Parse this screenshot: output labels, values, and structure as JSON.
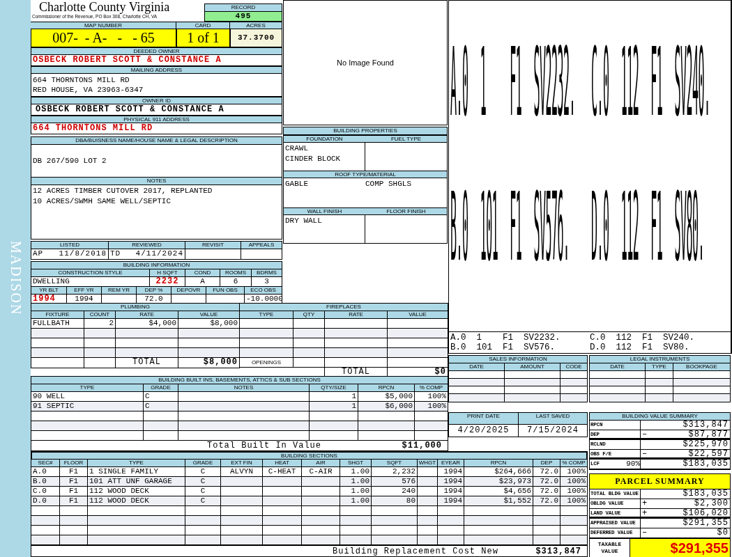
{
  "sidebar": {
    "district": "MADISON"
  },
  "header": {
    "county": "Charlotte County Virginia",
    "office": "Commissioner of the Revenue, PO Box 308, Charlotte CH, VA",
    "record_label": "RECORD",
    "record": "495"
  },
  "parcel": {
    "map_label": "MAP NUMBER",
    "map_number": "007-  - A-   -   - 65",
    "card_label": "CARD",
    "card": "1 of 1",
    "acres_label": "ACRES",
    "acres": "37.3700"
  },
  "owner": {
    "deeded_label": "DEEDED OWNER",
    "deeded": "OSBECK ROBERT SCOTT & CONSTANCE A",
    "mailing_label": "MAILING ADDRESS",
    "mailing_lines": [
      "664 THORNTONS MILL RD",
      "RED HOUSE, VA 23963-6347"
    ],
    "owner_id_label": "OWNER ID",
    "owner_id": "OSBECK ROBERT SCOTT & CONSTANCE A",
    "physical_label": "PHYSICAL 911 ADDRESS",
    "physical": "664 THORNTONS MILL RD"
  },
  "legal_description": {
    "label": "DBA/BUISNESS NAME/HOUSE NAME & LEGAL DESCRIPTION",
    "text": "DB 267/590 LOT 2"
  },
  "notes": {
    "label": "NOTES",
    "lines": [
      "12 ACRES TIMBER CUTOVER 2017, REPLANTED",
      "10 ACRES/SWMH SAME WELL/SEPTIC"
    ]
  },
  "review": {
    "columns": [
      "LISTED",
      "REVIEWED",
      "REVISIT",
      "APPEALS"
    ],
    "listed_by": "AP",
    "listed": "11/8/2018",
    "reviewed_by": "TD",
    "reviewed": "4/11/2024"
  },
  "building_info": {
    "title": "BUILDING INFORMATION",
    "construction": [
      {
        "label": "CONSTRUCTION STYLE",
        "value": "DWELLING",
        "highlight": false
      },
      {
        "label": "H SQFT",
        "value": "2232",
        "highlight": true
      },
      {
        "label": "COND",
        "value": "A",
        "highlight": false
      },
      {
        "label": "ROOMS",
        "value": "6",
        "highlight": false
      },
      {
        "label": "BDRMS",
        "value": "3",
        "highlight": false
      }
    ],
    "age": [
      {
        "label": "YR BLT",
        "value": "1994",
        "highlight": true
      },
      {
        "label": "EFF YR",
        "value": "1994",
        "highlight": false
      },
      {
        "label": "REM YR"
      },
      {
        "label": "DEP %",
        "value": "72.0",
        "highlight": false
      },
      {
        "label": "DEPOVR"
      },
      {
        "label": "FUN OBS"
      },
      {
        "label": "ECO OBS",
        "value": "-10.0000",
        "highlight": false
      }
    ]
  },
  "image": {
    "message": "No Image Found"
  },
  "building_properties": {
    "title": "BUILDING PROPERTIES",
    "foundation_label": "FOUNDATION",
    "foundation": [
      "CRAWL",
      "CINDER BLOCK"
    ],
    "fuel_label": "FUEL TYPE",
    "roof_label": "ROOF TYPE/MATERIAL",
    "roof_type": "GABLE",
    "roof_material": "COMP SHGLS",
    "wall_label": "WALL FINISH",
    "wall": "DRY WALL",
    "floor_label": "FLOOR FINISH"
  },
  "sketch": {
    "labels": [
      "A.0  1    F1  SV2232.",
      "C.0  112  F1  SV240.",
      "B.0  101  F1  SV576.",
      "D.0  112  F1  SV80."
    ]
  },
  "legend": [
    "A.0  1    F1  SV2232.",
    "C.0  112  F1  SV240.",
    "B.0  101  F1  SV576.",
    "D.0  112  F1  SV80."
  ],
  "plumbing": {
    "title": "PLUMBING",
    "columns": [
      "FIXTURE",
      "COUNT",
      "RATE",
      "VALUE"
    ],
    "rows": [
      [
        "FULLBATH",
        "2",
        "$4,000",
        "$8,000"
      ]
    ],
    "total_label": "TOTAL",
    "total": "$8,000"
  },
  "fireplaces": {
    "title": "FIREPLACES",
    "columns": [
      "TYPE",
      "QTY",
      "RATE",
      "VALUE"
    ],
    "openings_label": "OPENINGS",
    "total_label": "TOTAL",
    "total": "$0"
  },
  "built_ins": {
    "title": "BUILDING BUILT INS, BASEMENTS, ATTICS & SUB SECTIONS",
    "columns": [
      "TYPE",
      "GRADE",
      "NOTES",
      "QTY/SIZE",
      "RPCN",
      "% COMP"
    ],
    "rows": [
      {
        "type": "90 WELL",
        "grade": "C",
        "qty": "1",
        "rpcn": "$5,000",
        "comp": "100%"
      },
      {
        "type": "91 SEPTIC",
        "grade": "C",
        "qty": "1",
        "rpcn": "$6,000",
        "comp": "100%"
      }
    ],
    "total_label": "Total Built In Value",
    "total": "$11,000"
  },
  "sections": {
    "title": "BUILDING SECTIONS",
    "columns": [
      "SEC#",
      "FLOOR",
      "TYPE",
      "GRADE",
      "EXT FIN",
      "HEAT",
      "AIR",
      "SHGT",
      "SQFT",
      "WHGT",
      "EYEAR",
      "RPCN",
      "DEP",
      "% COMP"
    ],
    "rows": [
      {
        "sec": "A.0",
        "floor": "F1",
        "type": "1 SINGLE FAMILY",
        "grade": "C",
        "ext_fin": "ALVYN",
        "heat": "C-HEAT",
        "air": "C-AIR",
        "shgt": "1.00",
        "sqft": "2,232",
        "eyear": "1994",
        "rpcn": "$264,666",
        "dep": "72.0",
        "comp": "100%"
      },
      {
        "sec": "B.0",
        "floor": "F1",
        "type": "101 ATT UNF GARAGE",
        "grade": "C",
        "shgt": "1.00",
        "sqft": "576",
        "eyear": "1994",
        "rpcn": "$23,973",
        "dep": "72.0",
        "comp": "100%"
      },
      {
        "sec": "C.0",
        "floor": "F1",
        "type": "112 WOOD DECK",
        "grade": "C",
        "shgt": "1.00",
        "sqft": "240",
        "eyear": "1994",
        "rpcn": "$4,656",
        "dep": "72.0",
        "comp": "100%"
      },
      {
        "sec": "D.0",
        "floor": "F1",
        "type": "112 WOOD DECK",
        "grade": "C",
        "shgt": "1.00",
        "sqft": "80",
        "eyear": "1994",
        "rpcn": "$1,552",
        "dep": "72.0",
        "comp": "100%"
      }
    ],
    "total_label": "Building Replacement Cost New",
    "total": "$313,847"
  },
  "sales": {
    "title": "SALES INFORMATION",
    "columns": [
      "DATE",
      "AMOUNT",
      "CODE"
    ]
  },
  "legal_instruments": {
    "title": "LEGAL INSTRUMENTS",
    "columns": [
      "DATE",
      "TYPE",
      "BOOKPAGE"
    ]
  },
  "dates": {
    "print_label": "PRINT DATE",
    "print": "4/20/2025",
    "saved_label": "LAST SAVED",
    "saved": "7/15/2024"
  },
  "value_summary": {
    "title": "BUILDING VALUE SUMMARY",
    "rows": [
      {
        "label": "RPCN",
        "value": "$313,847",
        "rule_below": false
      },
      {
        "label": "DEP",
        "sign": "–",
        "value": "$87,877",
        "rule_below": true
      },
      {
        "label": "RCLND",
        "value": "$225,970",
        "rule_below": false
      },
      {
        "label": "OBS F/E",
        "sign": "–",
        "value": "$22,597",
        "rule_below": true
      },
      {
        "label": "LCF",
        "percent": "90%",
        "value": "$183,035",
        "rule_below": false
      }
    ]
  },
  "parcel_summary": {
    "title": "PARCEL SUMMARY",
    "rows": [
      {
        "label": "TOTAL BLDG VALUE",
        "value": "$183,035",
        "rule_below": false
      },
      {
        "label": "OBLDG VALUE",
        "sign": "+",
        "value": "$2,300",
        "rule_below": false
      },
      {
        "label": "LAND VALUE",
        "sign": "+",
        "value": "$106,020",
        "rule_below": true
      },
      {
        "label": "APPRAISED VALUE",
        "value": "$291,355",
        "rule_below": false
      },
      {
        "label": "DEFERRED VALUE",
        "sign": "–",
        "value": "$0",
        "rule_below": false
      }
    ],
    "taxable_label": "TAXABLE VALUE",
    "taxable": "$291,355"
  }
}
